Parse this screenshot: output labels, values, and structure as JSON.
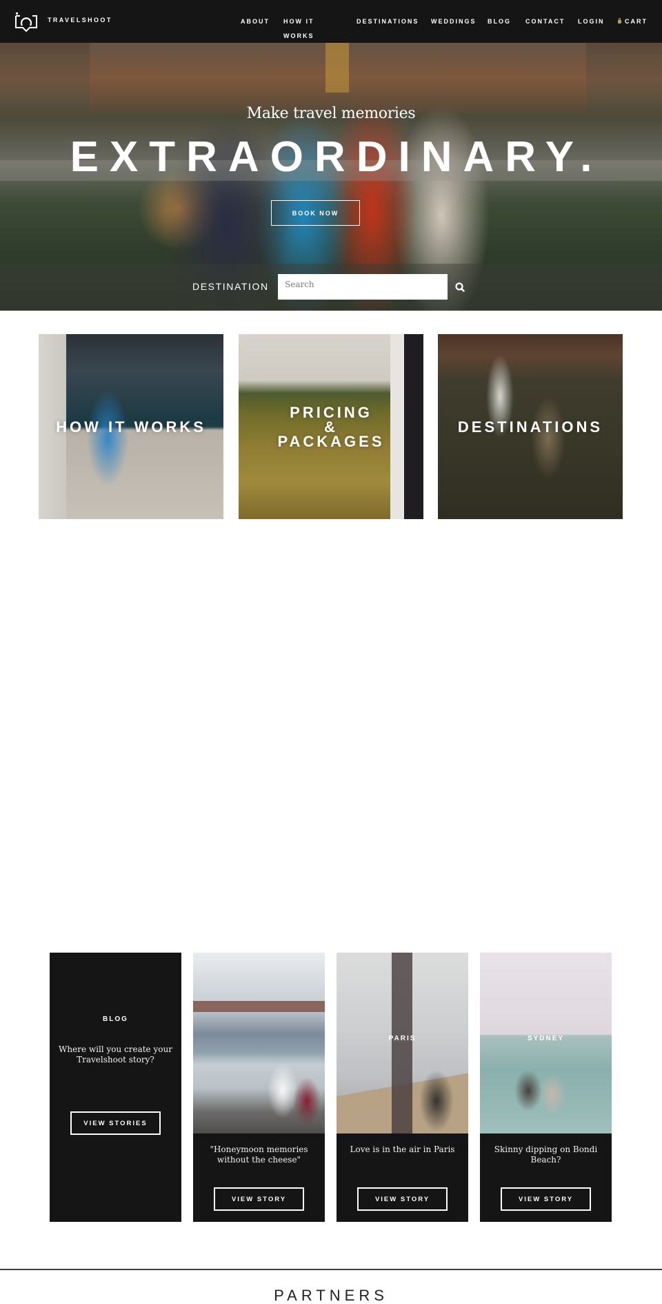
{
  "header": {
    "brand": "TRAVELSHOOT",
    "logo_icon": "camera-speech-bubble-icon",
    "nav": [
      {
        "label": "ABOUT"
      },
      {
        "label": "HOW IT"
      },
      {
        "label": "WORKS"
      },
      {
        "label": "DESTINATIONS"
      },
      {
        "label": "WEDDINGS"
      },
      {
        "label": "BLOG"
      },
      {
        "label": "CONTACT"
      },
      {
        "label": "LOGIN"
      },
      {
        "label": "CART",
        "icon": "lock-icon"
      }
    ]
  },
  "hero": {
    "subtitle": "Make travel memories",
    "title": "EXTRAORDINARY.",
    "cta_label": "BOOK NOW",
    "search": {
      "label": "DESTINATION",
      "placeholder": "Search",
      "value": "",
      "button_icon": "search-icon"
    }
  },
  "tiles": [
    {
      "label_lines": [
        "HOW IT WORKS"
      ]
    },
    {
      "label_lines": [
        "PRICING",
        "&",
        "PACKAGES"
      ]
    },
    {
      "label_lines": [
        "DESTINATIONS"
      ]
    }
  ],
  "blog": {
    "heading": "BLOG",
    "intro": "Where will you create your Travelshoot story?",
    "button_label": "VIEW STORIES",
    "stories": [
      {
        "city": "",
        "text": "\"Honeymoon memories without the cheese\"",
        "button_label": "VIEW STORY"
      },
      {
        "city": "PARIS",
        "text": "Love is in the air in Paris",
        "button_label": "VIEW STORY"
      },
      {
        "city": "SYDNEY",
        "text": "Skinny dipping on Bondi Beach?",
        "button_label": "VIEW STORY"
      }
    ]
  },
  "partners": {
    "heading": "PARTNERS"
  },
  "colors": {
    "header_bg": "#151515",
    "card_bg": "#151515",
    "text_light": "#ffffff",
    "lock_icon": "#b89a66",
    "divider": "#3e3e3e"
  }
}
